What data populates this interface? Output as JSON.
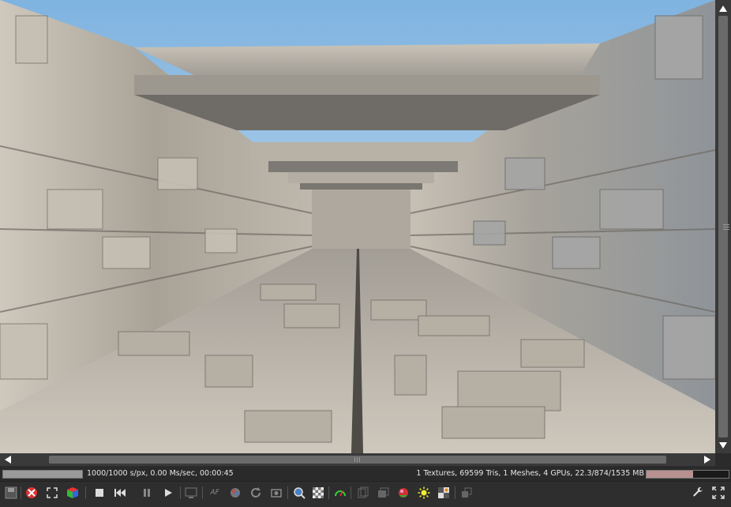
{
  "status": {
    "progress": 1.0,
    "left": "1000/1000 s/px, 0.00 Ms/sec, 00:00:45",
    "right": "1 Textures, 69599 Tris, 1 Meshes, 4 GPUs, 22.3/874/1535 MB",
    "memory_fraction": 0.57
  },
  "toolbar": {
    "af_label": "AF"
  },
  "colors": {
    "background": "#2b2b2b",
    "scrollbar": "#3a3a3a",
    "thumb": "#6a6a6a",
    "sky": "#a9cbe8",
    "stone": "#bdb6ac"
  }
}
